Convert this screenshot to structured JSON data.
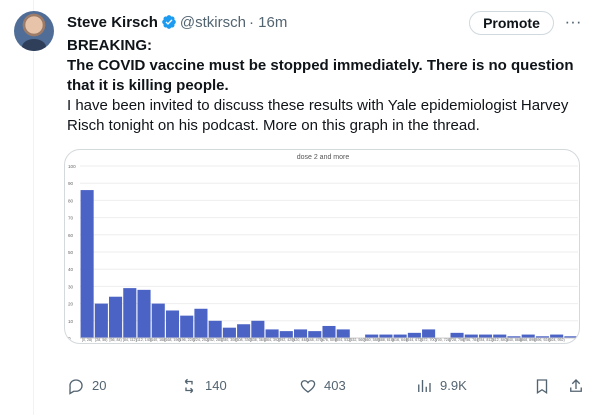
{
  "author": {
    "name": "Steve Kirsch",
    "handle": "@stkirsch",
    "time": "· 16m"
  },
  "actions": {
    "promote": "Promote",
    "more": "···"
  },
  "post": {
    "line1": "BREAKING:",
    "line2": "The COVID vaccine must be stopped immediately. There is no question that it is killing people.",
    "line3": "I have been invited to discuss these results with Yale epidemiologist Harvey Risch tonight on his podcast. More on this graph in the thread."
  },
  "stats": {
    "replies": "20",
    "reposts": "140",
    "likes": "403",
    "views": "9.9K"
  },
  "colors": {
    "bar": "#4c63c6",
    "muted": "#536471",
    "border": "#cfd9de"
  },
  "icons": {
    "reply": "reply-icon",
    "repost": "repost-icon",
    "like": "heart-icon",
    "views": "views-icon",
    "bookmark": "bookmark-icon",
    "share": "share-icon",
    "verified": "verified-badge-icon"
  },
  "chart_data": {
    "type": "bar",
    "title": "dose 2 and more",
    "ylim": [
      0,
      100
    ],
    "yticks": [
      0,
      10,
      20,
      30,
      40,
      50,
      60,
      70,
      80,
      90,
      100
    ],
    "categories": [
      "[0, 28)",
      "[28, 56)",
      "[56, 84)",
      "[84, 112)",
      "[112, 140)",
      "[140, 168)",
      "[168, 196)",
      "[196, 224)",
      "[224, 252)",
      "[252, 280)",
      "[280, 308)",
      "[308, 336)",
      "[336, 364)",
      "[364, 392)",
      "[392, 420)",
      "[420, 448)",
      "[448, 476)",
      "[476, 504)",
      "[504, 532)",
      "[532, 560)",
      "[560, 588)",
      "[588, 616)",
      "[616, 644)",
      "[644, 672)",
      "[672, 700)",
      "[700, 728)",
      "[728, 756)",
      "[756, 784)",
      "[784, 812)",
      "[812, 840)",
      "[840, 868)",
      "[868, 896)",
      "[896, 924)",
      "[924, 952)"
    ],
    "tick_labels": [
      "[0, 28)",
      "[28, 56)",
      "[56, 84)",
      "[84, 112)",
      "[112, 140)",
      "[140, 168)",
      "[168, 196)",
      "[196, 224)",
      "[224, 252)",
      "[252, 280)",
      "[280, 308)",
      "[308, 336)",
      "[336, 364)",
      "[364, 392)",
      "[392, 420)",
      "[420, 448)",
      "[448, 476)",
      "[476, 504)",
      "[504, 532)",
      "[532, 560)",
      "[560, 588)",
      "[588, 616)",
      "[616, 644)",
      "[644, 672)",
      "[672, 700)",
      "[700, 728)",
      "[728, 756)",
      "[756, 784)",
      "[784, 812)",
      "[812, 840)",
      "[840, 868)",
      "[868, 896)",
      "[896, 924)",
      "[924, 952)"
    ],
    "values": [
      86,
      20,
      24,
      29,
      28,
      20,
      16,
      13,
      17,
      10,
      6,
      8,
      10,
      5,
      4,
      5,
      4,
      7,
      5,
      0,
      2,
      2,
      2,
      3,
      5,
      0,
      3,
      2,
      2,
      2,
      1,
      2,
      1,
      2,
      1
    ],
    "grid": true,
    "legend": "none"
  }
}
